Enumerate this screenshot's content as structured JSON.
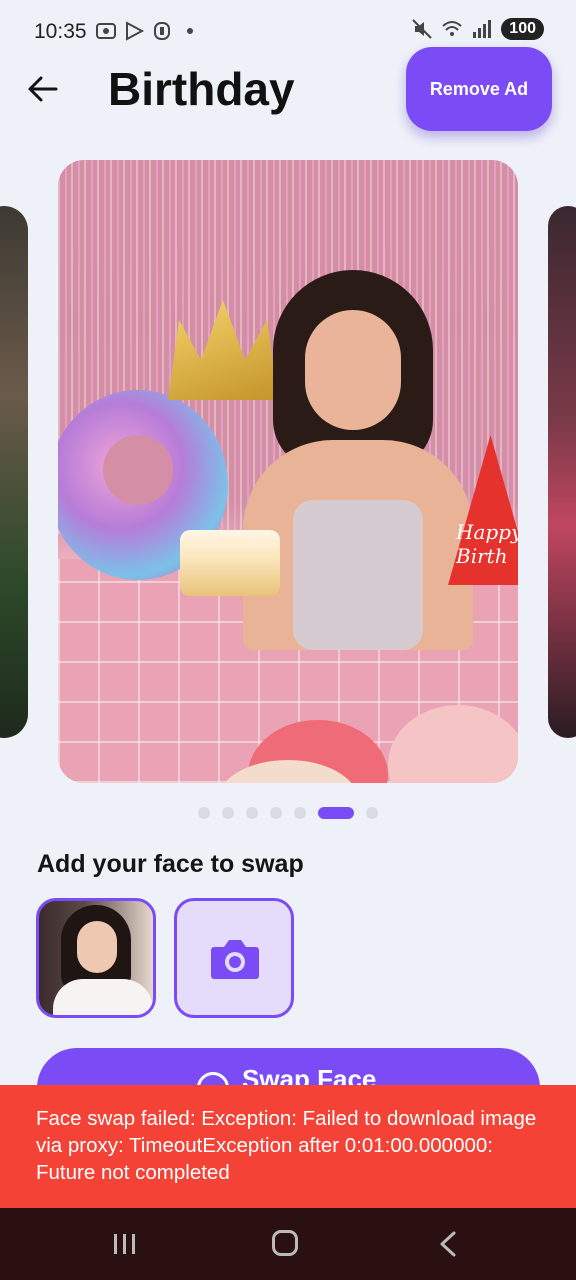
{
  "status_bar": {
    "time": "10:35",
    "battery": "100",
    "icons": [
      "screenshot-icon",
      "play-store-icon",
      "shield-icon",
      "mute-icon",
      "wifi-icon",
      "signal-icon"
    ]
  },
  "header": {
    "title": "Birthday",
    "remove_ad_label": "Remove Ad"
  },
  "carousel": {
    "page_count": 7,
    "active_index": 5,
    "card_hat_text": "Happy Birth"
  },
  "face_section": {
    "heading": "Add your face to swap"
  },
  "swap_button": {
    "label": "Swap Face"
  },
  "snackbar": {
    "message": "Face swap failed: Exception: Failed to download image via proxy: TimeoutException after 0:01:00.000000: Future not completed"
  },
  "colors": {
    "accent": "#7b4cf6",
    "error": "#f44336",
    "background": "#eef2f8",
    "navbar": "#2a1010"
  }
}
